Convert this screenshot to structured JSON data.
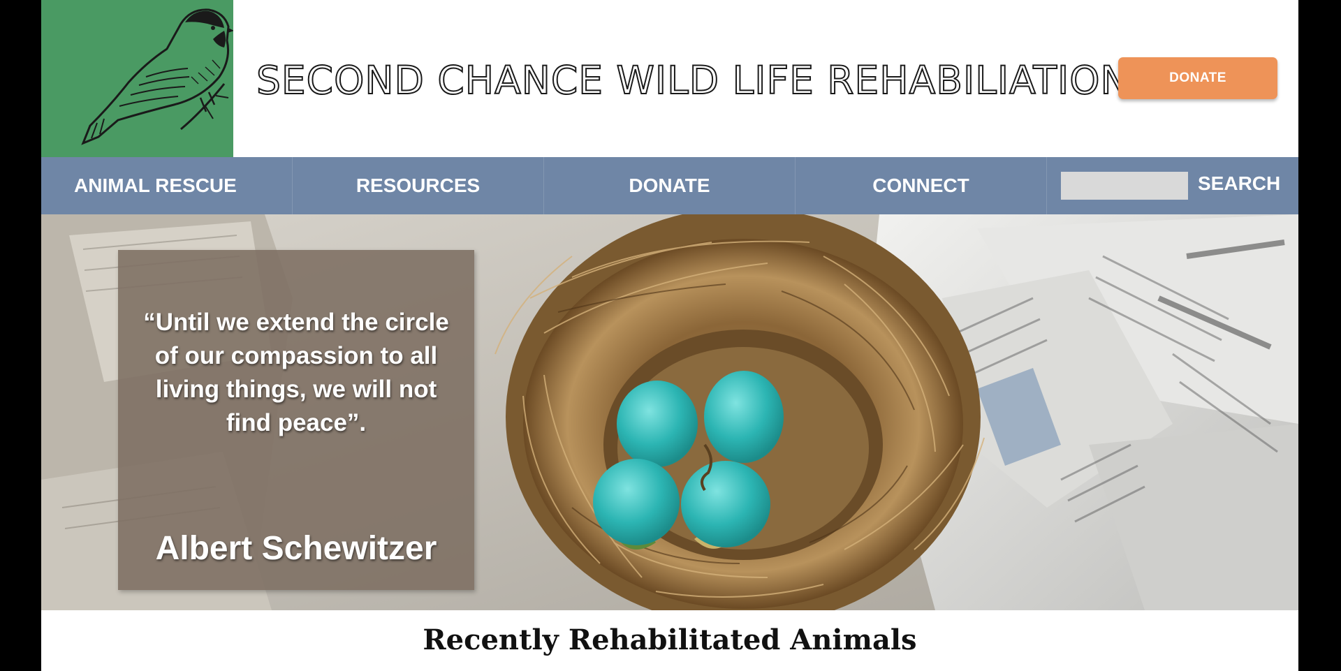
{
  "header": {
    "site_title": "SECOND CHANCE WILD LIFE REHABILIATION",
    "donate_button": "DONATE",
    "logo_icon": "chickadee-bird-icon",
    "colors": {
      "logo_bg": "#4a9a63",
      "donate_bg": "#ee9358"
    }
  },
  "nav": {
    "items": [
      {
        "label": "ANIMAL RESCUE"
      },
      {
        "label": "RESOURCES"
      },
      {
        "label": "DONATE"
      },
      {
        "label": "CONNECT"
      }
    ],
    "search": {
      "label": "SEARCH",
      "value": ""
    },
    "colors": {
      "bg": "#6f86a6"
    }
  },
  "hero": {
    "quote": "“Until we extend the circle of our compassion to all living things, we will not find peace”.",
    "author": "Albert Schewitzer"
  },
  "section": {
    "title": "Recently Rehabilitated Animals"
  }
}
